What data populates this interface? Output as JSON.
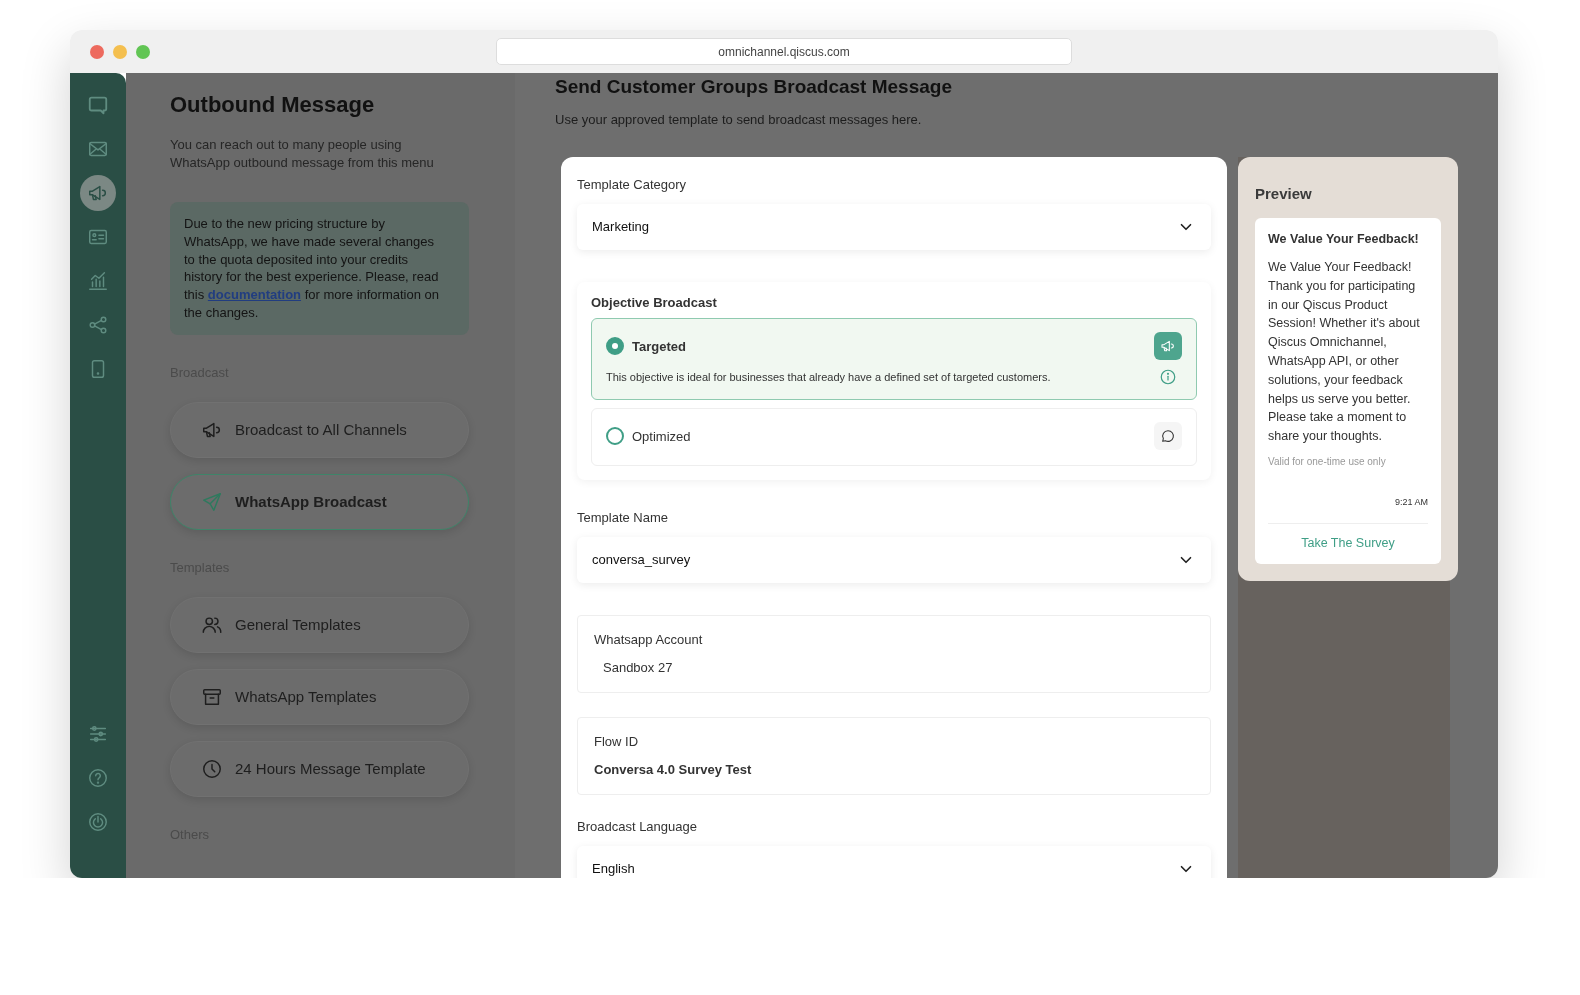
{
  "window": {
    "url": "omnichannel.qiscus.com"
  },
  "sidebar": {
    "items": [
      {
        "selected": false
      },
      {
        "selected": false
      },
      {
        "selected": true
      },
      {
        "selected": false
      },
      {
        "selected": false
      },
      {
        "selected": false
      },
      {
        "selected": false
      }
    ]
  },
  "left_panel": {
    "title": "Outbound Message",
    "description": "You can reach out to many people using WhatsApp outbound message from this menu",
    "notice": {
      "before": "Due to the new pricing structure by WhatsApp, we have made several changes to the quota deposited into your credits history for the best experience. Please, read this",
      "link": "documentation",
      "after": "for more information on the changes."
    },
    "sections": [
      {
        "title": "Broadcast",
        "items": [
          {
            "label": "Broadcast to All Channels",
            "selected": false
          },
          {
            "label": "WhatsApp Broadcast",
            "selected": true
          }
        ]
      },
      {
        "title": "Templates",
        "items": [
          {
            "label": "General Templates",
            "selected": false
          },
          {
            "label": "WhatsApp Templates",
            "selected": false
          },
          {
            "label": "24 Hours Message Template",
            "selected": false
          }
        ]
      },
      {
        "title": "Others"
      }
    ]
  },
  "main": {
    "title": "Send Customer Groups Broadcast Message",
    "subtitle": "Use your approved template to send broadcast messages here.",
    "fields": [
      {
        "kind": "select",
        "label": "Template Category",
        "value": "Marketing"
      },
      {
        "kind": "objective",
        "label": "Objective Broadcast",
        "options": [
          {
            "label": "Targeted",
            "selected": true,
            "description": "This objective is ideal for businesses that already have a defined set of targeted customers."
          },
          {
            "label": "Optimized",
            "selected": false
          }
        ]
      },
      {
        "kind": "select",
        "label": "Template Name",
        "value": "conversa_survey"
      },
      {
        "kind": "readonly",
        "label": "Whatsapp Account",
        "value": "Sandbox 27",
        "strong": false
      },
      {
        "kind": "readonly",
        "label": "Flow ID",
        "value": "Conversa 4.0 Survey Test",
        "strong": true
      },
      {
        "kind": "select",
        "label": "Broadcast Language",
        "value": "English"
      }
    ]
  },
  "preview": {
    "title": "Preview",
    "message": {
      "heading": "We Value Your Feedback!",
      "body": "We Value Your Feedback! Thank you for participating in our Qiscus Product Session! Whether it's about Qiscus Omnichannel, WhatsApp API, or other solutions, your feedback helps us serve you better. Please take a moment to share your thoughts.",
      "footer": "Valid for one-time use only",
      "time": "9:21 AM",
      "button": "Take The Survey"
    }
  }
}
